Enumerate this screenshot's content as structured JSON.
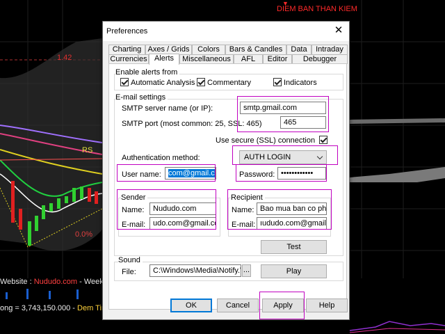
{
  "background": {
    "top_marker": "DIEM BAN THAN KIEM",
    "level_label": "1.42",
    "rs_label": "RS",
    "pct_label": "0.0%",
    "footer_line1_prefix": "Website :",
    "footer_line1_site": "Nududo.com",
    "footer_line1_suffix": "- Weekly",
    "footer_line2_prefix": "ong = 3,743,150.000 -",
    "footer_line2_time": "Dem Time"
  },
  "dialog": {
    "title": "Preferences",
    "tabs_row1": [
      "Charting",
      "Axes / Grids",
      "Colors",
      "Bars & Candles",
      "Data",
      "Intraday"
    ],
    "tabs_row2": [
      "Currencies",
      "Alerts",
      "Miscellaneous",
      "AFL",
      "Editor",
      "Debugger"
    ],
    "enable_alerts": {
      "title": "Enable alerts from",
      "automatic_analysis": "Automatic Analysis",
      "commentary": "Commentary",
      "indicators": "Indicators"
    },
    "email_settings": {
      "title": "E-mail settings",
      "smtp_server_label": "SMTP server name (or IP):",
      "smtp_server_value": "smtp.gmail.com",
      "smtp_port_label": "SMTP port (most common: 25, SSL: 465)",
      "smtp_port_value": "465",
      "ssl_label": "Use secure (SSL) connection",
      "auth_label": "Authentication method:",
      "auth_value": "AUTH LOGIN",
      "username_label": "User name:",
      "username_value": "com@gmail.com",
      "password_label": "Password:",
      "password_value": "••••••••••••"
    },
    "sender": {
      "title": "Sender",
      "name_label": "Name:",
      "name_value": "Nududo.com",
      "email_label": "E-mail:",
      "email_value": "udo.com@gmail.com"
    },
    "recipient": {
      "title": "Recipient",
      "name_label": "Name:",
      "name_value": "Bao mua ban co phieu",
      "email_label": "E-mail:",
      "email_value": "ıududo.com@gmail.com"
    },
    "test_button": "Test",
    "sound": {
      "title": "Sound",
      "file_label": "File:",
      "file_value": "C:\\Windows\\Media\\Notify.WAV",
      "browse": "...",
      "play": "Play"
    },
    "buttons": {
      "ok": "OK",
      "cancel": "Cancel",
      "apply": "Apply",
      "help": "Help"
    }
  }
}
